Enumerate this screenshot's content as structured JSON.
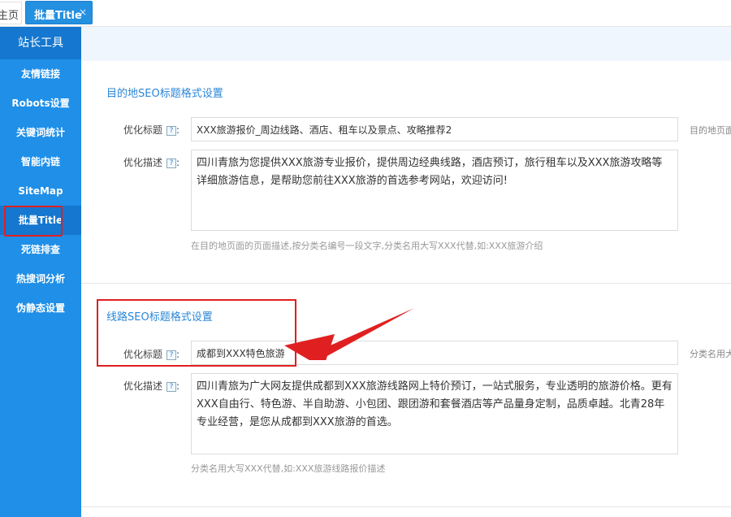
{
  "tabs": {
    "home_label": "主页",
    "active_label": "批量Title",
    "close_symbol": "×"
  },
  "sidebar": {
    "header": "站长工具",
    "items": [
      {
        "label": "友情链接"
      },
      {
        "label": "Robots设置"
      },
      {
        "label": "关键词统计"
      },
      {
        "label": "智能内链"
      },
      {
        "label": "SiteMap"
      },
      {
        "label": "批量Title",
        "active": true
      },
      {
        "label": "死链排查"
      },
      {
        "label": "热搜词分析"
      },
      {
        "label": "伪静态设置"
      }
    ]
  },
  "destination": {
    "title": "目的地SEO标题格式设置",
    "opt_title_label": "优化标题",
    "opt_title_value": "XXX旅游报价_周边线路、酒店、租车以及景点、攻略推荐2",
    "opt_title_side_hint": "目的地页面",
    "opt_desc_label": "优化描述",
    "opt_desc_value": "四川青旅为您提供XXX旅游专业报价，提供周边经典线路，酒店预订，旅行租车以及XXX旅游攻略等详细旅游信息，是帮助您前往XXX旅游的首选参考网站，欢迎访问!",
    "opt_desc_hint": "在目的地页面的页面描述,按分类名编号一段文字,分类名用大写XXX代替,如:XXX旅游介绍"
  },
  "route": {
    "title": "线路SEO标题格式设置",
    "opt_title_label": "优化标题",
    "opt_title_value": "成都到XXX特色旅游",
    "opt_title_side_hint": "分类名用大",
    "opt_desc_label": "优化描述",
    "opt_desc_value": "四川青旅为广大网友提供成都到XXX旅游线路网上特价预订，一站式服务，专业透明的旅游价格。更有XXX自由行、特色游、半自助游、小包团、跟团游和套餐酒店等产品量身定制，品质卓越。北青28年专业经营，是您从成都到XXX旅游的首选。",
    "opt_desc_hint": "分类名用大写XXX代替,如:XXX旅游线路报价描述"
  },
  "help_symbol": "?",
  "colon": ":",
  "colors": {
    "sidebar": "#1f8fe8",
    "sidebar_active": "#1577cf",
    "accent": "#2a87d8",
    "annotation_red": "#e02020"
  }
}
